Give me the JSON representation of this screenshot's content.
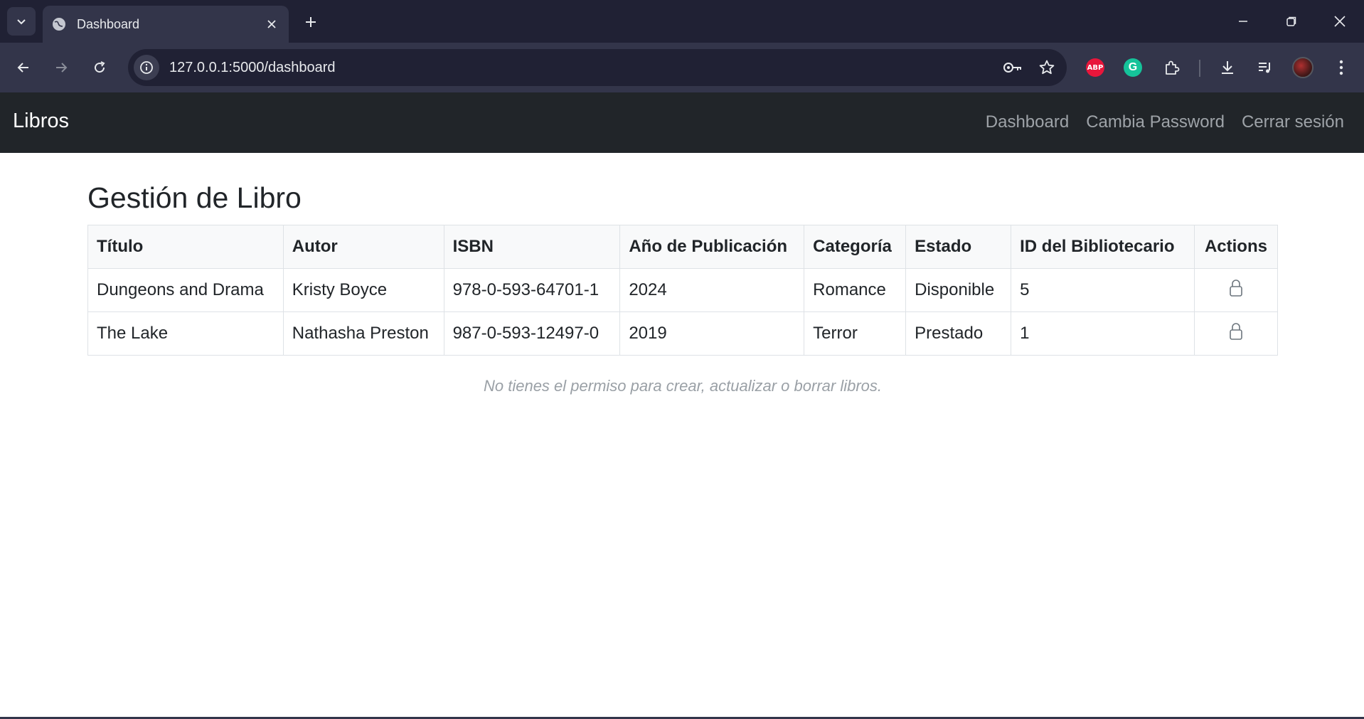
{
  "browser": {
    "tab_title": "Dashboard",
    "url": "127.0.0.1:5000/dashboard",
    "extensions": {
      "abp_label": "ABP",
      "grammarly_label": "G"
    }
  },
  "navbar": {
    "brand": "Libros",
    "links": [
      "Dashboard",
      "Cambia Password",
      "Cerrar sesión"
    ]
  },
  "main": {
    "title": "Gestión de Libro",
    "table": {
      "columns": [
        "Título",
        "Autor",
        "ISBN",
        "Año de Publicación",
        "Categoría",
        "Estado",
        "ID del Bibliotecario",
        "Actions"
      ],
      "rows": [
        [
          "Dungeons and Drama",
          "Kristy Boyce",
          "978-0-593-64701-1",
          "2024",
          "Romance",
          "Disponible",
          "5"
        ],
        [
          "The Lake",
          "Nathasha Preston",
          "987-0-593-12497-0",
          "2019",
          "Terror",
          "Prestado",
          "1"
        ]
      ],
      "action_icon": "lock-icon"
    },
    "notice": "No tienes el permiso para crear, actualizar o borrar libros."
  },
  "colors": {
    "navbar_bg": "#212529",
    "chrome_bg": "#202134",
    "toolbar_bg": "#33354a",
    "header_row_bg": "#f8f9fa"
  }
}
